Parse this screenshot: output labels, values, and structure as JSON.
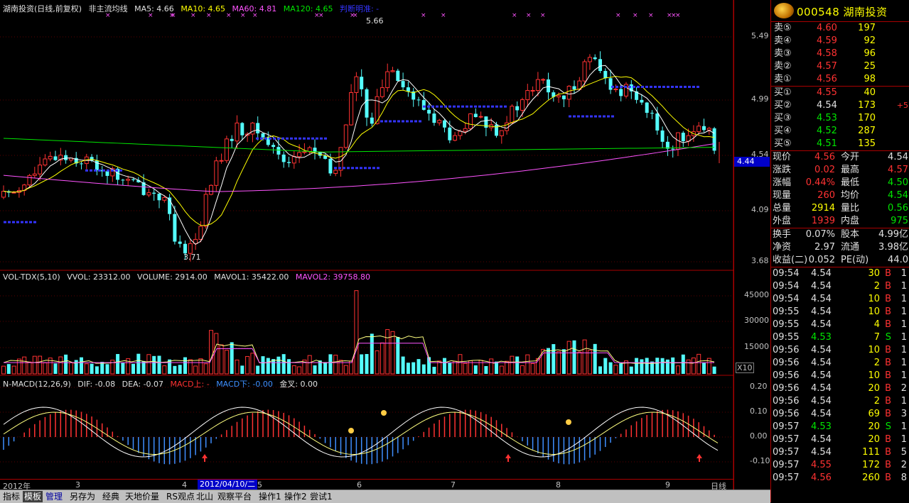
{
  "price_title": {
    "name": "湖南投资(日线,前复权)",
    "indicator": "非主流均线",
    "ma5": "MA5: 4.66",
    "ma10": "MA10: 4.65",
    "ma60": "MA60: 4.81",
    "ma120": "MA120: 4.65",
    "judge": "判断明准: -"
  },
  "price_axis": [
    "5.49",
    "4.99",
    "4.54",
    "4.09",
    "3.68"
  ],
  "price_marker": "4.44",
  "high_label": "5.66",
  "low_label": "3.71",
  "vol_title": {
    "name": "VOL-TDX(5,10)",
    "vvol": "VVOL: 23312.00",
    "volume": "VOLUME: 2914.00",
    "mavol1": "MAVOL1: 35422.00",
    "mavol2": "MAVOL2: 39758.80"
  },
  "vol_axis": [
    "45000",
    "30000",
    "15000"
  ],
  "vol_unit": "X10",
  "macd_title": {
    "name": "N-MACD(12,26,9)",
    "dif": "DIF: -0.08",
    "dea": "DEA: -0.07",
    "up": "MACD上: -",
    "down": "MACD下: -0.00",
    "cross": "金叉: 0.00"
  },
  "macd_axis": [
    "0.20",
    "0.10",
    "0.00",
    "-0.10"
  ],
  "x_axis": [
    "2012年",
    "3",
    "4",
    "5",
    "6",
    "7",
    "8",
    "9"
  ],
  "date_popup": "2012/04/10/二",
  "period_label": "日线",
  "tabs": [
    "指标",
    "模板",
    "管理",
    "另存为",
    "经典",
    "天地价量",
    "RS观点",
    "北山",
    "观察平台",
    "操作1",
    "操作2",
    "尝试1"
  ],
  "stock": {
    "code": "000548",
    "name": "湖南投资"
  },
  "sells": [
    {
      "label": "卖⑤",
      "price": "4.60",
      "vol": "197"
    },
    {
      "label": "卖④",
      "price": "4.59",
      "vol": "92"
    },
    {
      "label": "卖③",
      "price": "4.58",
      "vol": "96"
    },
    {
      "label": "卖②",
      "price": "4.57",
      "vol": "25"
    },
    {
      "label": "卖①",
      "price": "4.56",
      "vol": "98"
    }
  ],
  "buys": [
    {
      "label": "买①",
      "price": "4.55",
      "vol": "40",
      "chg": ""
    },
    {
      "label": "买②",
      "price": "4.54",
      "vol": "173",
      "chg": "+5"
    },
    {
      "label": "买③",
      "price": "4.53",
      "vol": "170",
      "chg": ""
    },
    {
      "label": "买④",
      "price": "4.52",
      "vol": "287",
      "chg": ""
    },
    {
      "label": "买⑤",
      "price": "4.51",
      "vol": "135",
      "chg": ""
    }
  ],
  "quote": [
    {
      "l1": "现价",
      "v1": "4.56",
      "c1": "red",
      "l2": "今开",
      "v2": "4.54",
      "c2": "white"
    },
    {
      "l1": "涨跌",
      "v1": "0.02",
      "c1": "red",
      "l2": "最高",
      "v2": "4.57",
      "c2": "red"
    },
    {
      "l1": "涨幅",
      "v1": "0.44%",
      "c1": "red",
      "l2": "最低",
      "v2": "4.50",
      "c2": "green"
    },
    {
      "l1": "现量",
      "v1": "260",
      "c1": "red",
      "l2": "均价",
      "v2": "4.54",
      "c2": "green"
    },
    {
      "l1": "总量",
      "v1": "2914",
      "c1": "yellow",
      "l2": "量比",
      "v2": "0.56",
      "c2": "green"
    },
    {
      "l1": "外盘",
      "v1": "1939",
      "c1": "red",
      "l2": "内盘",
      "v2": "975",
      "c2": "green"
    }
  ],
  "fund": [
    {
      "l1": "换手",
      "v1": "0.07%",
      "l2": "股本",
      "v2": "4.99亿"
    },
    {
      "l1": "净资",
      "v1": "2.97",
      "l2": "流通",
      "v2": "3.98亿"
    },
    {
      "l1": "收益(二)",
      "v1": "0.052",
      "l2": "PE(动)",
      "v2": "44.0"
    }
  ],
  "ticks": [
    {
      "t": "09:54",
      "p": "4.54",
      "pc": "white",
      "v": "30",
      "s": "B",
      "sc": "red",
      "n": "1"
    },
    {
      "t": "09:54",
      "p": "4.54",
      "pc": "white",
      "v": "2",
      "s": "B",
      "sc": "red",
      "n": "1"
    },
    {
      "t": "09:54",
      "p": "4.54",
      "pc": "white",
      "v": "10",
      "s": "B",
      "sc": "red",
      "n": "1"
    },
    {
      "t": "09:55",
      "p": "4.54",
      "pc": "white",
      "v": "10",
      "s": "B",
      "sc": "red",
      "n": "1"
    },
    {
      "t": "09:55",
      "p": "4.54",
      "pc": "white",
      "v": "4",
      "s": "B",
      "sc": "red",
      "n": "1"
    },
    {
      "t": "09:55",
      "p": "4.53",
      "pc": "green",
      "v": "7",
      "s": "S",
      "sc": "green",
      "n": "1"
    },
    {
      "t": "09:56",
      "p": "4.54",
      "pc": "white",
      "v": "10",
      "s": "B",
      "sc": "red",
      "n": "1"
    },
    {
      "t": "09:56",
      "p": "4.54",
      "pc": "white",
      "v": "2",
      "s": "B",
      "sc": "red",
      "n": "1"
    },
    {
      "t": "09:56",
      "p": "4.54",
      "pc": "white",
      "v": "10",
      "s": "B",
      "sc": "red",
      "n": "1"
    },
    {
      "t": "09:56",
      "p": "4.54",
      "pc": "white",
      "v": "20",
      "s": "B",
      "sc": "red",
      "n": "2"
    },
    {
      "t": "09:56",
      "p": "4.54",
      "pc": "white",
      "v": "2",
      "s": "B",
      "sc": "red",
      "n": "1"
    },
    {
      "t": "09:56",
      "p": "4.54",
      "pc": "white",
      "v": "69",
      "s": "B",
      "sc": "red",
      "n": "3"
    },
    {
      "t": "09:57",
      "p": "4.53",
      "pc": "green",
      "v": "20",
      "s": "S",
      "sc": "green",
      "n": "1"
    },
    {
      "t": "09:57",
      "p": "4.54",
      "pc": "white",
      "v": "20",
      "s": "B",
      "sc": "red",
      "n": "1"
    },
    {
      "t": "09:57",
      "p": "4.54",
      "pc": "white",
      "v": "111",
      "s": "B",
      "sc": "red",
      "n": "5"
    },
    {
      "t": "09:57",
      "p": "4.55",
      "pc": "red",
      "v": "172",
      "s": "B",
      "sc": "red",
      "n": "2"
    },
    {
      "t": "09:57",
      "p": "4.56",
      "pc": "red",
      "v": "260",
      "s": "B",
      "sc": "red",
      "n": "8"
    }
  ],
  "colors": {
    "up": "#ff3232",
    "down": "#54fcfc",
    "ma5": "#ffffff",
    "ma10": "#ffff00",
    "ma60": "#ff54ff",
    "ma120": "#00e600",
    "bar": "#3434ff"
  }
}
